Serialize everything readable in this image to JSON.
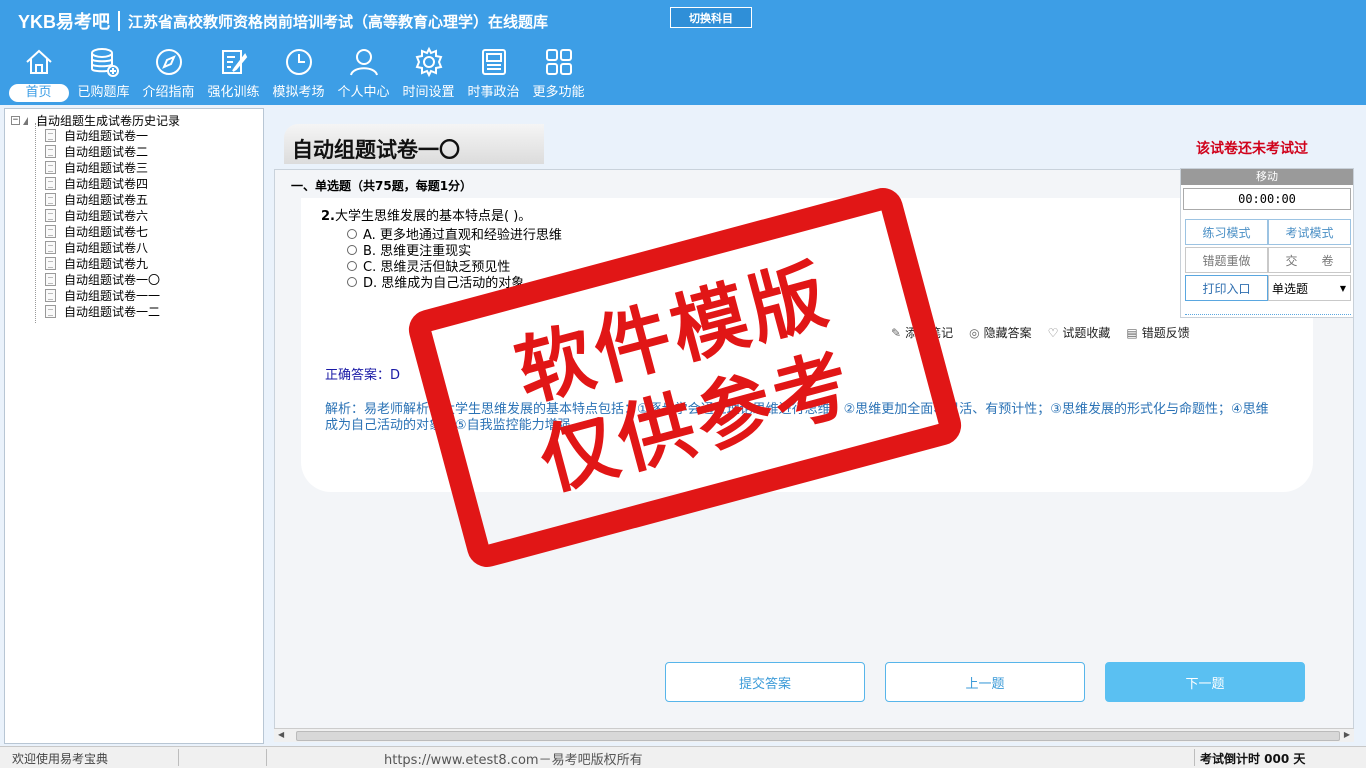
{
  "header": {
    "logo": "YKB易考吧",
    "title": "江苏省高校教师资格岗前培训考试（高等教育心理学）在线题库",
    "switch_subject": "切换科目"
  },
  "nav": [
    {
      "label": "首页",
      "icon": "home-icon"
    },
    {
      "label": "已购题库",
      "icon": "database-icon"
    },
    {
      "label": "介绍指南",
      "icon": "compass-icon"
    },
    {
      "label": "强化训练",
      "icon": "edit-icon"
    },
    {
      "label": "模拟考场",
      "icon": "clock-icon"
    },
    {
      "label": "个人中心",
      "icon": "user-icon"
    },
    {
      "label": "时间设置",
      "icon": "gear-icon"
    },
    {
      "label": "时事政治",
      "icon": "news-icon"
    },
    {
      "label": "更多功能",
      "icon": "grid-icon"
    }
  ],
  "tree": {
    "root": "自动组题生成试卷历史记录",
    "items": [
      "自动组题试卷一",
      "自动组题试卷二",
      "自动组题试卷三",
      "自动组题试卷四",
      "自动组题试卷五",
      "自动组题试卷六",
      "自动组题试卷七",
      "自动组题试卷八",
      "自动组题试卷九",
      "自动组题试卷一〇",
      "自动组题试卷一一",
      "自动组题试卷一二"
    ]
  },
  "paper": {
    "title": "自动组题试卷一〇",
    "status": "该试卷还未考试过",
    "section": "一、单选题（共75题，每题1分）"
  },
  "question": {
    "number": "2.",
    "stem": "大学生思维发展的基本特点是(  )。",
    "options": [
      "A. 更多地通过直观和经验进行思维",
      "B. 思维更注重现实",
      "C. 思维灵活但缺乏预见性",
      "D. 思维成为自己活动的对象"
    ],
    "answer": "正确答案：D",
    "analysis": "解析：易老师解析，大学生思维发展的基本特点包括：①逐步学会通过理论思维进行思维；②思维更加全面、灵活、有预计性；③思维发展的形式化与命题性；④思维成为自己活动的对象；⑤自我监控能力增强。"
  },
  "tools": {
    "note": "添加笔记",
    "hide_answer": "隐藏答案",
    "favorite": "试题收藏",
    "feedback": "错题反馈"
  },
  "buttons": {
    "submit": "提交答案",
    "prev": "上一题",
    "next": "下一题"
  },
  "side": {
    "move": "移动",
    "timer": "00:00:00",
    "practice_mode": "练习模式",
    "exam_mode": "考试模式",
    "redo_wrong": "错题重做",
    "hand_in": "交　　卷",
    "print": "打印入口",
    "qtype": "单选题"
  },
  "watermark": {
    "line1": "软件模版",
    "line2": "仅供参考"
  },
  "statusbar": {
    "welcome": "欢迎使用易考宝典",
    "copyright": "https://www.etest8.com－易考吧版权所有",
    "countdown": "考试倒计时 000 天"
  }
}
